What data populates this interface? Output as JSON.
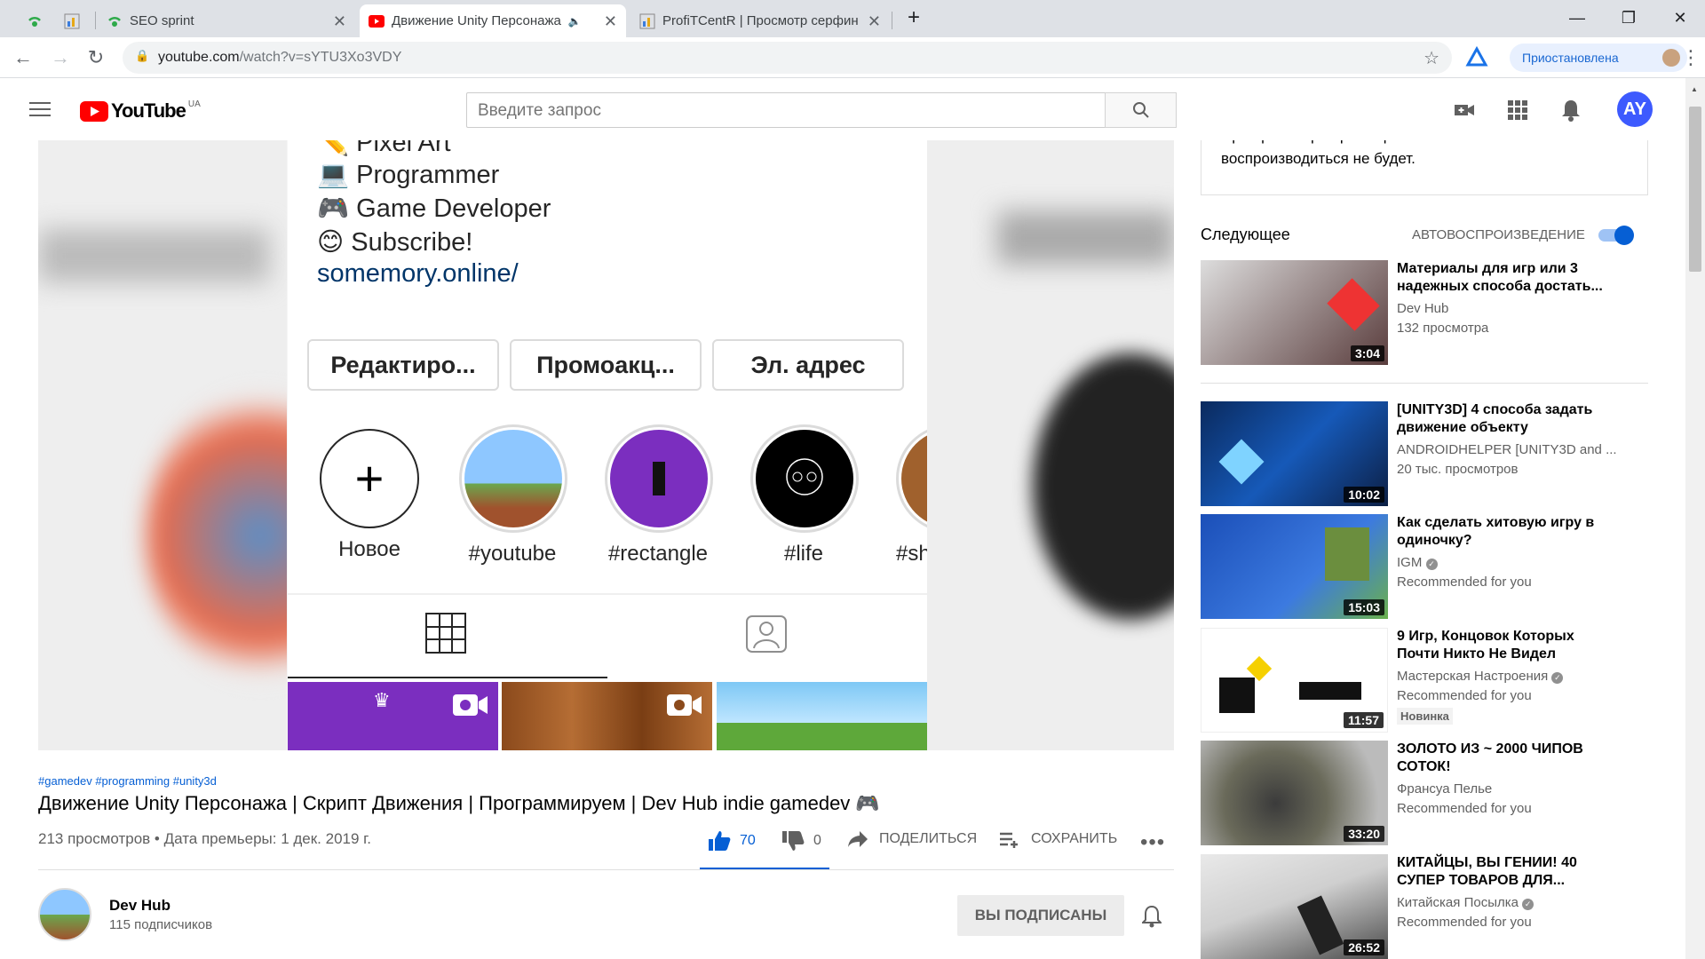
{
  "browser": {
    "tabs": [
      {
        "title": ""
      },
      {
        "title": ""
      },
      {
        "title": "SEO sprint"
      },
      {
        "title": "Движение Unity Персонажа"
      },
      {
        "title": "ProfiTCentR | Просмотр серфинг"
      }
    ],
    "url_host": "youtube.com",
    "url_path": "/watch?v=sYTU3Xo3VDY",
    "profile_label": "Приостановлена"
  },
  "youtube": {
    "logo_text": "YouTube",
    "region": "UA",
    "search_placeholder": "Введите запрос",
    "avatar_initials": "AY"
  },
  "phone": {
    "bio": [
      "Pixel Art",
      "Programmer",
      "Game Developer",
      "Subscribe!",
      "somemory.online/"
    ],
    "buttons": [
      "Редактиро...",
      "Промоакц...",
      "Эл. адрес"
    ],
    "highlights": [
      "Новое",
      "#youtube",
      "#rectangle",
      "#life",
      "#sh"
    ]
  },
  "video": {
    "tags": "#gamedev #programming #unity3d",
    "title": "Движение Unity Персонажа | Скрипт Движения | Программируем | Dev Hub indie gamedev 🎮",
    "meta": "213 просмотров • Дата премьеры: 1 дек. 2019 г.",
    "likes": "70",
    "dislikes": "0",
    "share": "ПОДЕЛИТЬСЯ",
    "save": "СОХРАНИТЬ",
    "channel": "Dev Hub",
    "subscribers": "115 подписчиков",
    "subscribed_label": "ВЫ ПОДПИСАНЫ"
  },
  "sidebar": {
    "chat_note_1": "При просмотре премьеры в записи чат",
    "chat_note_2": "воспроизводиться не будет.",
    "up_next": "Следующее",
    "autoplay": "АВТОВОСПРОИЗВЕДЕНИЕ",
    "videos": [
      {
        "title": "Материалы для игр или 3 надежных способа достать...",
        "channel": "Dev Hub",
        "views": "132 просмотра",
        "duration": "3:04",
        "badge": ""
      },
      {
        "title": "[UNITY3D] 4 способа задать движение объекту",
        "channel": "ANDROIDHELPER [UNITY3D and ...",
        "views": "20 тыс. просмотров",
        "duration": "10:02",
        "badge": ""
      },
      {
        "title": "Как сделать хитовую игру в одиночку?",
        "channel": "IGM",
        "views": "Recommended for you",
        "duration": "15:03",
        "badge": ""
      },
      {
        "title": "9 Игр, Концовок Которых Почти Никто Не Видел",
        "channel": "Мастерская Настроения",
        "views": "Recommended for you",
        "duration": "11:57",
        "badge": "Новинка"
      },
      {
        "title": "ЗОЛОТО ИЗ ~ 2000 ЧИПОВ СОТОК!",
        "channel": "Франсуа Пелье",
        "views": "Recommended for you",
        "duration": "33:20",
        "badge": ""
      },
      {
        "title": "КИТАЙЦЫ, ВЫ ГЕНИИ! 40 СУПЕР ТОВАРОВ ДЛЯ...",
        "channel": "Китайская Посылка",
        "views": "Recommended for you",
        "duration": "26:52",
        "badge": ""
      }
    ]
  },
  "colors": {
    "youtube_red": "#ff0000",
    "link_blue": "#065fd4",
    "toggle_blue": "#065fd4",
    "instagram_purple": "#7b2ebf"
  }
}
